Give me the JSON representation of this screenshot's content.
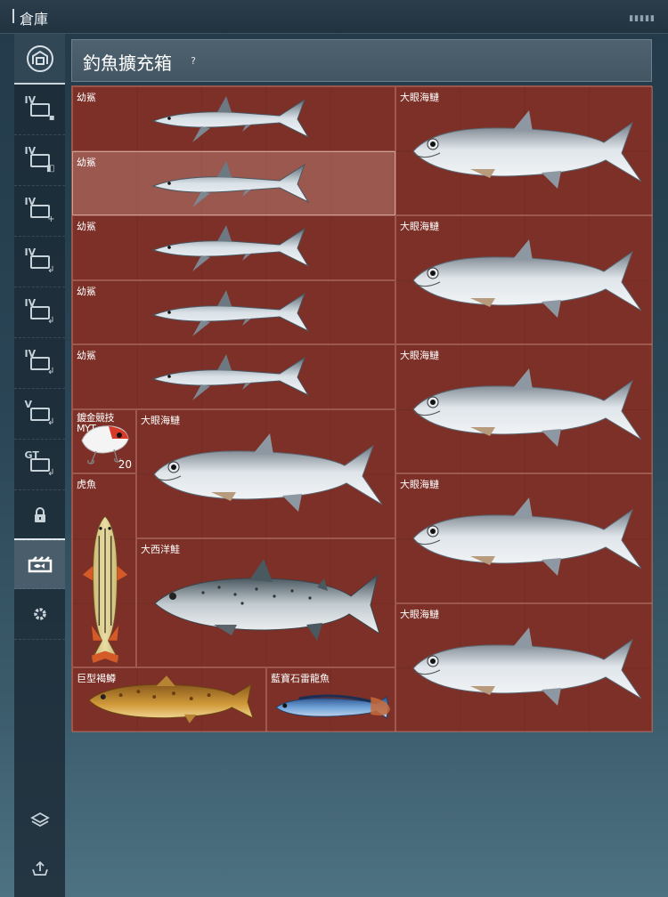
{
  "window": {
    "title": "倉庫",
    "status_dots": "▮▮▮▮▮"
  },
  "sidebar": {
    "items": [
      {
        "icon": "warehouse-icon"
      },
      {
        "tier": "IV",
        "icon": "tackle-box-icon"
      },
      {
        "tier": "IV",
        "icon": "tackle-box-icon"
      },
      {
        "tier": "IV",
        "icon": "tackle-box-add-icon"
      },
      {
        "tier": "IV",
        "icon": "tackle-box-hook-icon"
      },
      {
        "tier": "IV",
        "icon": "tackle-box-hook-icon"
      },
      {
        "tier": "IV",
        "icon": "tackle-box-hook-icon"
      },
      {
        "tier": "V",
        "icon": "tackle-box-hook-icon"
      },
      {
        "tier": "GT",
        "icon": "tackle-box-hook-icon"
      },
      {
        "icon": "lock-icon"
      },
      {
        "icon": "fish-box-icon"
      },
      {
        "icon": "gear-icon"
      },
      {
        "icon": "layers-icon"
      },
      {
        "icon": "upload-icon"
      }
    ]
  },
  "panel": {
    "title": "釣魚擴充箱",
    "help": "?"
  },
  "cells": [
    {
      "name": "幼鯊",
      "fish": "shark"
    },
    {
      "name": "幼鯊",
      "fish": "shark"
    },
    {
      "name": "幼鯊",
      "fish": "shark"
    },
    {
      "name": "幼鯊",
      "fish": "shark"
    },
    {
      "name": "幼鯊",
      "fish": "shark"
    },
    {
      "name": "大眼海鰱",
      "fish": "tarpon"
    },
    {
      "name": "大眼海鰱",
      "fish": "tarpon"
    },
    {
      "name": "大眼海鰱",
      "fish": "tarpon"
    },
    {
      "name": "大眼海鰱",
      "fish": "tarpon"
    },
    {
      "name": "大眼海鰱",
      "fish": "tarpon"
    },
    {
      "name": "鍍金競技MYT",
      "count": "20",
      "fish": "lure"
    },
    {
      "name": "大眼海鰱",
      "fish": "tarpon"
    },
    {
      "name": "虎魚",
      "fish": "tigerfish"
    },
    {
      "name": "大西洋鮭",
      "fish": "salmon"
    },
    {
      "name": "巨型褐鱒",
      "fish": "trout"
    },
    {
      "name": "藍寶石雷龍魚",
      "fish": "snakehead"
    }
  ],
  "colors": {
    "grid_bg": "#7c3128",
    "accent": "#dfe7ec"
  }
}
